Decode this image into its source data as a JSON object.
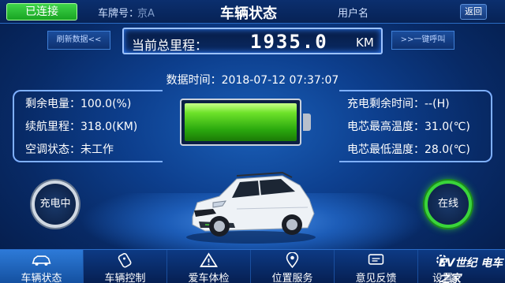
{
  "header": {
    "connection_status": "已连接",
    "plate_label": "车牌号：",
    "plate_value": "京A",
    "title": "车辆状态",
    "user_label": "用户名",
    "user_value": "",
    "back_label": "返回"
  },
  "odometer": {
    "refresh_label": "刷新数据<<",
    "call_label": ">>一键呼叫",
    "label": "当前总里程：",
    "value": "1935.0",
    "unit": "KM"
  },
  "timestamp": {
    "label": "数据时间：",
    "value": "2018-07-12 07:37:07"
  },
  "left_info": [
    {
      "label": "剩余电量：",
      "value": "100.0(%)"
    },
    {
      "label": "续航里程：",
      "value": "318.0(KM)"
    },
    {
      "label": "空调状态：",
      "value": "未工作"
    }
  ],
  "right_info": [
    {
      "label": "充电剩余时间：",
      "value": "--(H)"
    },
    {
      "label": "电芯最高温度：",
      "value": "31.0(℃)"
    },
    {
      "label": "电芯最低温度：",
      "value": "28.0(℃)"
    }
  ],
  "battery": {
    "level": 1.0,
    "color": "#3ab81a"
  },
  "status": {
    "charging_label": "充电中",
    "online_label": "在线",
    "online_color": "#3ad53a"
  },
  "nav": [
    {
      "label": "车辆状态",
      "icon": "car-icon",
      "active": true
    },
    {
      "label": "车辆控制",
      "icon": "key-fob-icon",
      "active": false
    },
    {
      "label": "爱车体检",
      "icon": "warning-icon",
      "active": false
    },
    {
      "label": "位置服务",
      "icon": "location-pin-icon",
      "active": false
    },
    {
      "label": "意见反馈",
      "icon": "feedback-icon",
      "active": false
    },
    {
      "label": "设置",
      "icon": "settings-icon",
      "active": false
    }
  ],
  "watermark": "EV世纪 电车之家"
}
